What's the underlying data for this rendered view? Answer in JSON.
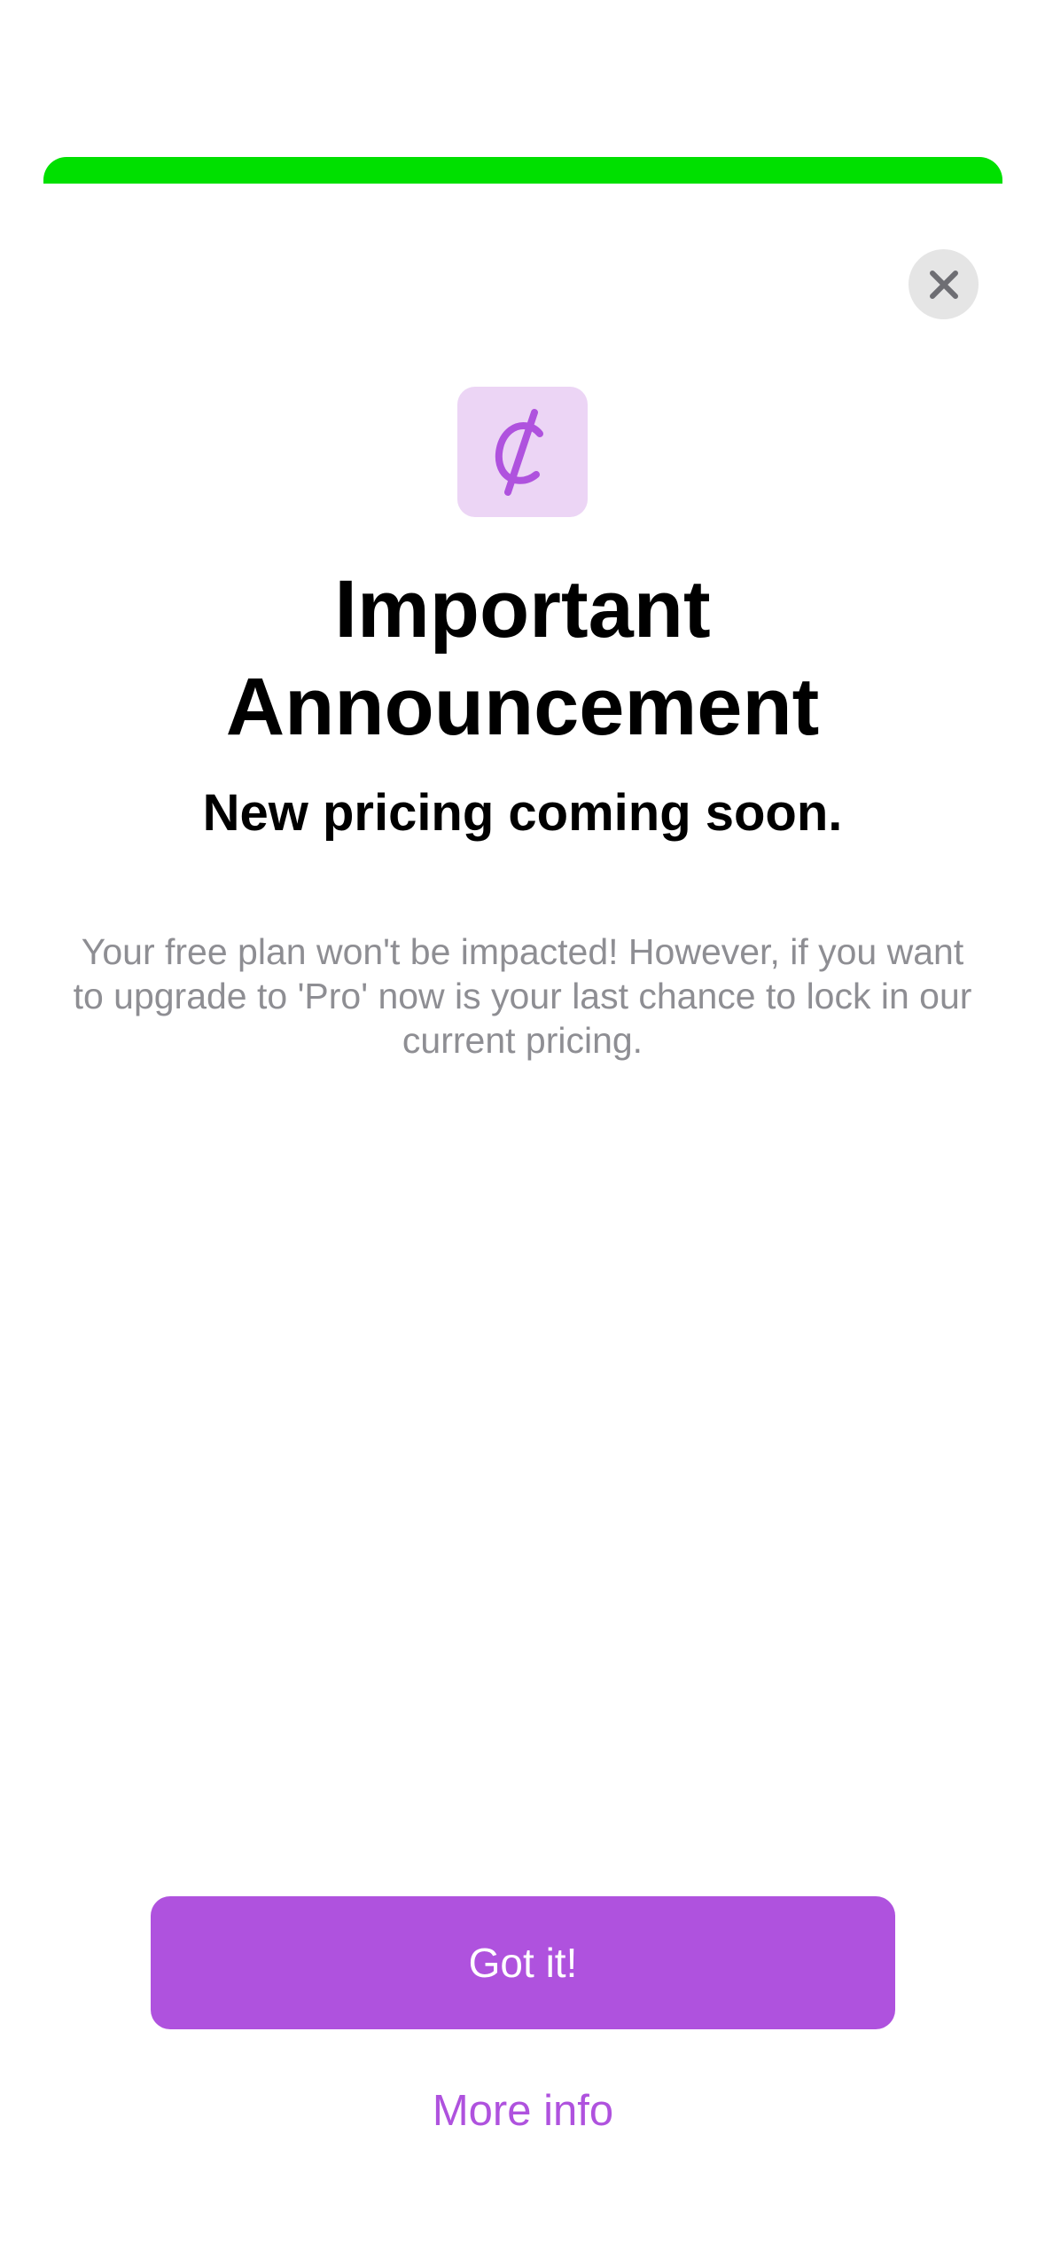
{
  "colors": {
    "top_bar": "#00e000",
    "accent": "#af52de",
    "icon_bg": "#ecd5f5",
    "close_bg": "#e5e5e5",
    "close_glyph": "#6e6e73",
    "body_text": "#8e8e93"
  },
  "icons": {
    "app": "cent-sign-icon",
    "close": "close-icon"
  },
  "announcement": {
    "title_line1": "Important",
    "title_line2": "Announcement",
    "subtitle": "New pricing coming soon.",
    "body": "Your free plan won't be impacted! However, if you want to upgrade to 'Pro' now is your last chance to lock in our current pricing."
  },
  "actions": {
    "primary_label": "Got it!",
    "secondary_label": "More info"
  }
}
